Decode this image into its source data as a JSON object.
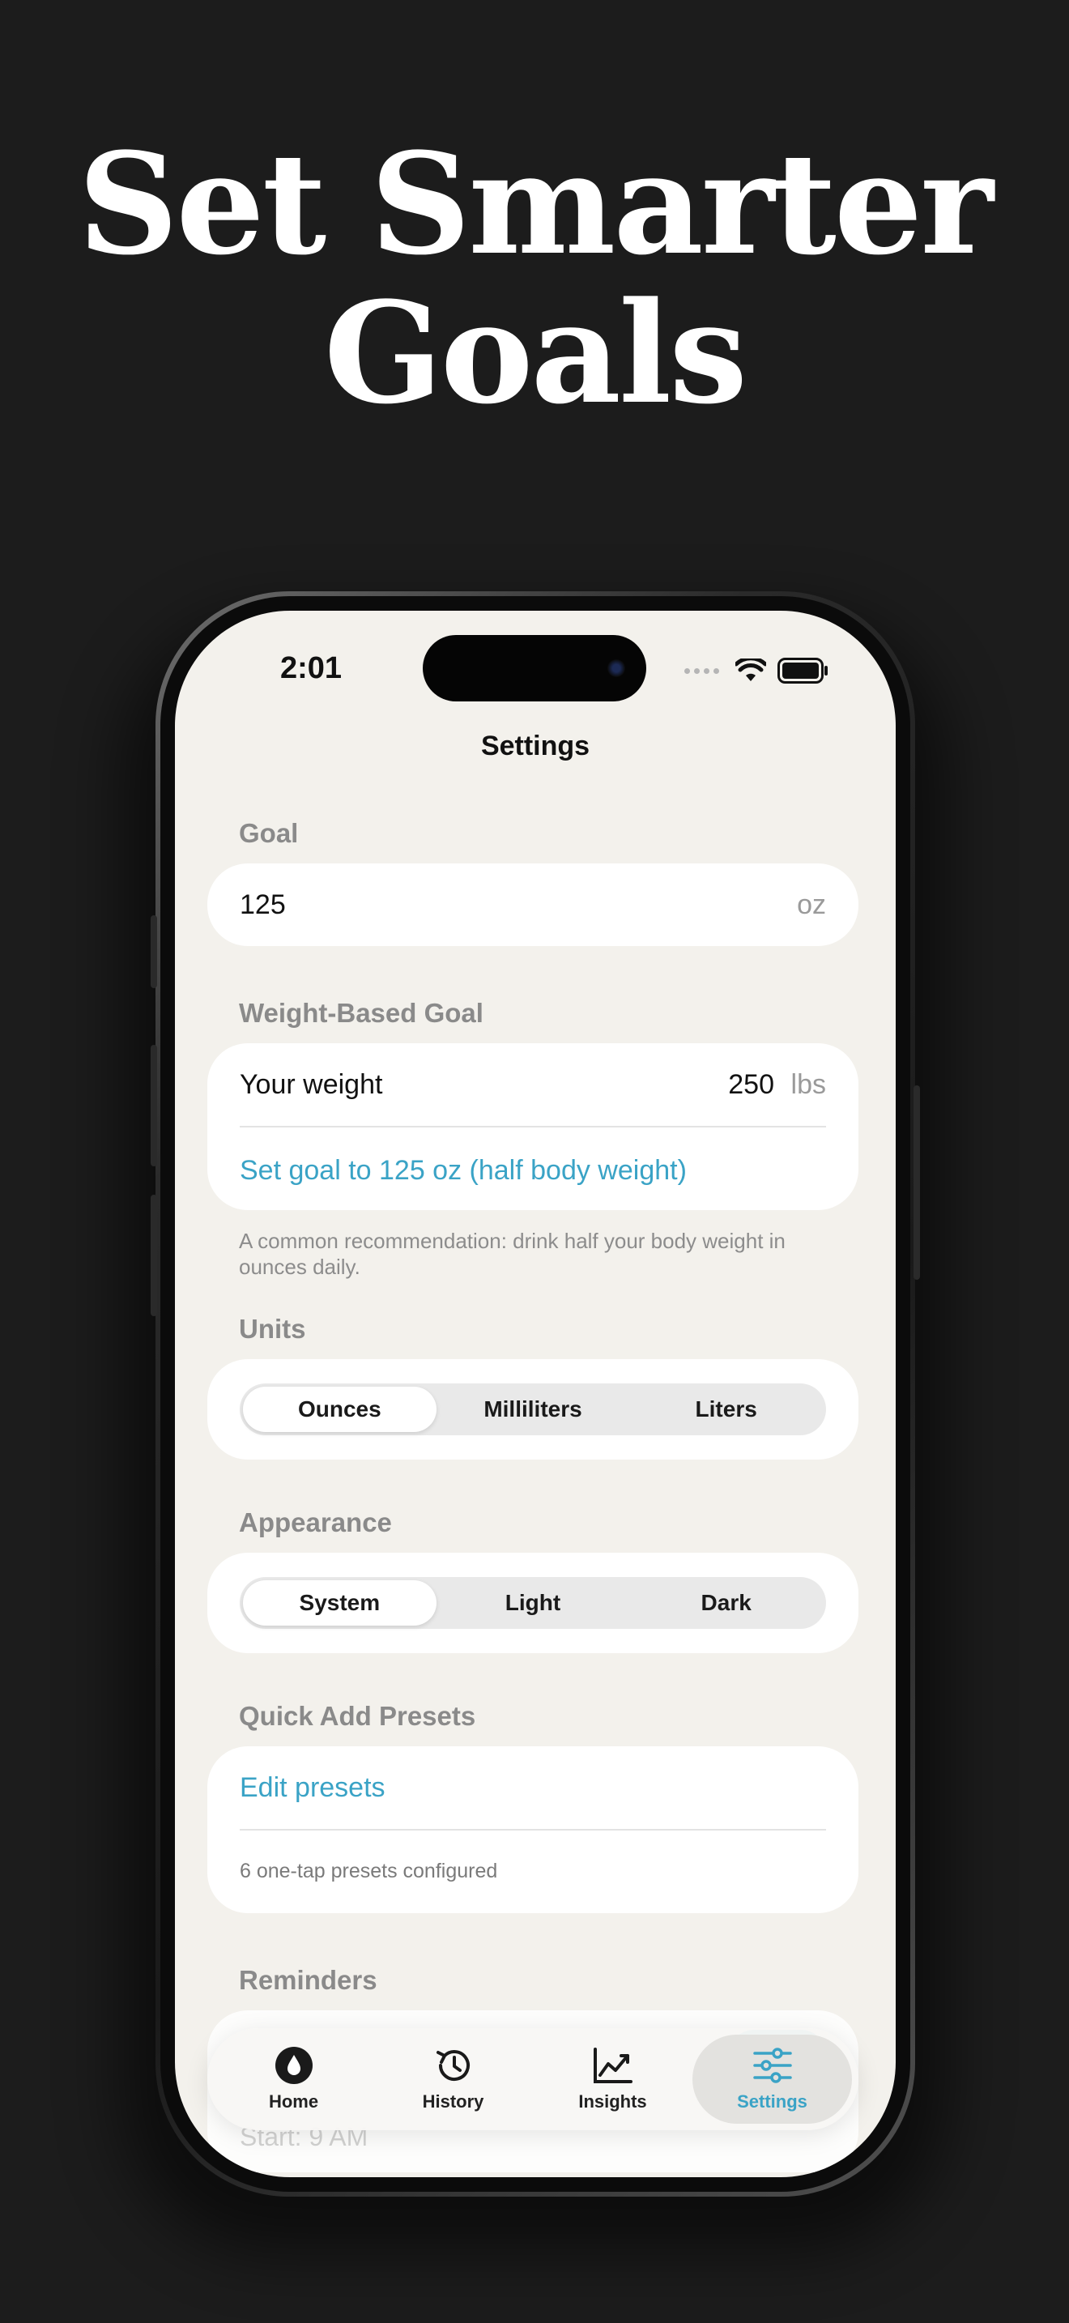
{
  "headline": {
    "line1": "Set Smarter",
    "line2": "Goals"
  },
  "status_bar": {
    "time": "2:01"
  },
  "nav": {
    "title": "Settings"
  },
  "goal": {
    "section": "Goal",
    "value": "125",
    "unit": "oz"
  },
  "weight_goal": {
    "section": "Weight-Based Goal",
    "weight_label": "Your weight",
    "weight_value": "250",
    "weight_unit": "lbs",
    "action": "Set goal to 125 oz (half body weight)",
    "footnote": "A common recommendation: drink half your body weight in ounces daily."
  },
  "units": {
    "section": "Units",
    "options": [
      "Ounces",
      "Milliliters",
      "Liters"
    ],
    "selected": "Ounces"
  },
  "appearance": {
    "section": "Appearance",
    "options": [
      "System",
      "Light",
      "Dark"
    ],
    "selected": "System"
  },
  "presets": {
    "section": "Quick Add Presets",
    "action": "Edit presets",
    "caption": "6 one-tap presets configured"
  },
  "reminders": {
    "section": "Reminders",
    "start": "Start: 9 AM"
  },
  "tabbar": {
    "items": [
      {
        "label": "Home",
        "icon": "drop-icon"
      },
      {
        "label": "History",
        "icon": "history-icon"
      },
      {
        "label": "Insights",
        "icon": "chart-icon"
      },
      {
        "label": "Settings",
        "icon": "sliders-icon"
      }
    ],
    "active": "Settings"
  },
  "colors": {
    "accent": "#3aa3c6",
    "background": "#1c1c1c",
    "screen": "#f3f1ec"
  }
}
